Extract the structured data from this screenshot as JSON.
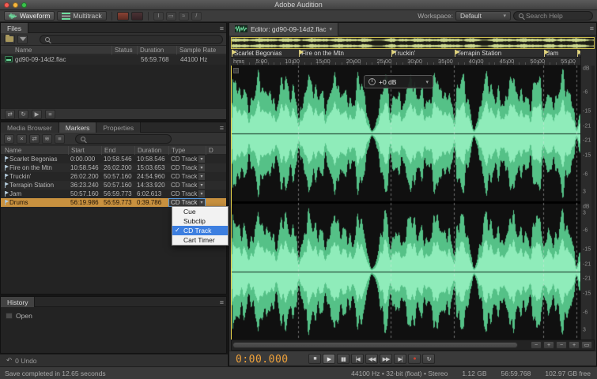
{
  "titlebar": {
    "title": "Adobe Audition"
  },
  "toolbar": {
    "waveform_label": "Waveform",
    "multitrack_label": "Multitrack",
    "tool_glyphs": [
      "I",
      "▭",
      "≈",
      "/"
    ],
    "workspace_label": "Workspace:",
    "workspace_value": "Default",
    "search_placeholder": "Search Help"
  },
  "files_panel": {
    "tab": "Files",
    "columns": [
      "Name",
      "Status",
      "Duration",
      "Sample Rate"
    ],
    "file": {
      "name": "gd90-09-14d2.flac",
      "duration": "56:59.768",
      "sample_rate": "44100 Hz"
    },
    "footer_buttons": [
      {
        "name": "insert-into-multitrack-button",
        "glyph": "⇄"
      },
      {
        "name": "loop-playback-button",
        "glyph": "↻"
      },
      {
        "name": "auto-play-button",
        "glyph": "▶"
      },
      {
        "name": "files-options-button",
        "glyph": "≡"
      }
    ]
  },
  "markers_panel": {
    "tabs": [
      "Media Browser",
      "Markers",
      "Properties"
    ],
    "active_tab": "Markers",
    "toolbar_buttons": [
      {
        "name": "add-marker-button",
        "glyph": "⊕"
      },
      {
        "name": "delete-marker-button",
        "glyph": "×"
      },
      {
        "name": "merge-markers-button",
        "glyph": "⇄"
      },
      {
        "name": "export-markers-button",
        "glyph": "≋"
      },
      {
        "name": "marker-options-button",
        "glyph": "≡"
      }
    ],
    "columns": [
      "Name",
      "Start",
      "End",
      "Duration",
      "Type",
      "D"
    ],
    "rows": [
      {
        "name": "Scarlet Begonias",
        "start": "0:00.000",
        "end": "10:58.546",
        "duration": "10:58.546",
        "type": "CD Track"
      },
      {
        "name": "Fire on the Mtn",
        "start": "10:58.546",
        "end": "26:02.200",
        "duration": "15:03.653",
        "type": "CD Track"
      },
      {
        "name": "Truckin'",
        "start": "26:02.200",
        "end": "50:57.160",
        "duration": "24:54.960",
        "type": "CD Track"
      },
      {
        "name": "Terrapin Station",
        "start": "36:23.240",
        "end": "50:57.160",
        "duration": "14:33.920",
        "type": "CD Track"
      },
      {
        "name": "Jam",
        "start": "50:57.160",
        "end": "56:59.773",
        "duration": "6:02.613",
        "type": "CD Track"
      },
      {
        "name": "Drums",
        "start": "56:19.986",
        "end": "56:59.773",
        "duration": "0:39.786",
        "type": "CD Track"
      }
    ],
    "selected_row": "Drums",
    "type_menu": {
      "items": [
        "Cue",
        "Subclip",
        "CD Track",
        "Cart Timer"
      ],
      "selected": "CD Track",
      "check_glyph": "✓"
    }
  },
  "history_panel": {
    "tab": "History",
    "items": [
      "Open"
    ],
    "undo_status": "0 Undo"
  },
  "editor": {
    "tab_label": "Editor: gd90-09-14d2.flac",
    "ruler_unit": "hms",
    "ruler_ticks": [
      {
        "label": "5:00",
        "pos": 0.0877
      },
      {
        "label": "10:00",
        "pos": 0.1754
      },
      {
        "label": "15:00",
        "pos": 0.2632
      },
      {
        "label": "20:00",
        "pos": 0.3509
      },
      {
        "label": "25:00",
        "pos": 0.4386
      },
      {
        "label": "30:00",
        "pos": 0.5263
      },
      {
        "label": "35:00",
        "pos": 0.6141
      },
      {
        "label": "40:00",
        "pos": 0.7018
      },
      {
        "label": "45:00",
        "pos": 0.7895
      },
      {
        "label": "50:00",
        "pos": 0.8772
      },
      {
        "label": "55:00",
        "pos": 0.965
      }
    ],
    "markers": [
      {
        "name": "Scarlet Begonias",
        "pos": 0.0
      },
      {
        "name": "Fire on the Mtn",
        "pos": 0.1926
      },
      {
        "name": "Truckin'",
        "pos": 0.4568
      },
      {
        "name": "Terrapin Station",
        "pos": 0.6384
      },
      {
        "name": "Jam",
        "pos": 0.894
      },
      {
        "name": "Drums",
        "pos": 0.9884
      }
    ],
    "hud_value": "+0 dB",
    "db_unit": "dB",
    "db_labels": [
      "3",
      "-6",
      "-15",
      "-21"
    ],
    "transport": {
      "time": "0:00.000",
      "buttons": [
        {
          "name": "stop-button",
          "glyph": "■"
        },
        {
          "name": "play-button",
          "glyph": "▶"
        },
        {
          "name": "pause-button",
          "glyph": "▮▮"
        },
        {
          "name": "skip-back-button",
          "glyph": "|◀"
        },
        {
          "name": "rewind-button",
          "glyph": "◀◀"
        },
        {
          "name": "fast-forward-button",
          "glyph": "▶▶"
        },
        {
          "name": "skip-forward-button",
          "glyph": "▶|"
        },
        {
          "name": "record-button",
          "glyph": "●",
          "color": "#cc4433"
        },
        {
          "name": "loop-button",
          "glyph": "↻"
        }
      ]
    },
    "zoom_buttons": [
      {
        "name": "zoom-out-horizontal-button",
        "glyph": "−"
      },
      {
        "name": "zoom-in-horizontal-button",
        "glyph": "+"
      },
      {
        "name": "zoom-out-vertical-button",
        "glyph": "−"
      },
      {
        "name": "zoom-in-vertical-button",
        "glyph": "+"
      },
      {
        "name": "zoom-full-button",
        "glyph": "▭"
      }
    ],
    "status": {
      "format": "44100 Hz • 32-bit (float) • Stereo",
      "size": "1.12 GB",
      "duration": "56:59.768",
      "free": "102.97 GB free"
    }
  },
  "statusbar": {
    "save_message": "Save completed in 12.65 seconds"
  },
  "colors": {
    "waveform_green": "#55c187",
    "waveform_green_bright": "#8fecba",
    "selection_orange": "#c8913f",
    "accent_blue": "#3d7fe0",
    "time_orange": "#f0a23a",
    "overview_yellow": "#cdbc4e"
  }
}
